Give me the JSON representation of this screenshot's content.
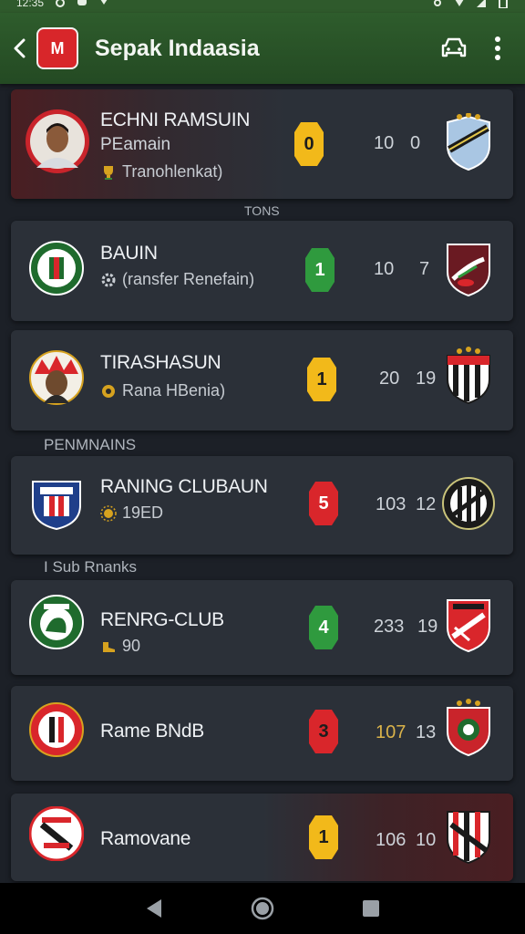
{
  "status_bar": {
    "time": "12:35"
  },
  "app_bar": {
    "title": "Sepak Indaasia",
    "logo_text": "M"
  },
  "sections": [
    "TONS",
    "PENMNAINS",
    "I Sub Rnanks"
  ],
  "matches": [
    {
      "title": "ECHNI RAMSUIN",
      "subtitle": "PEamain",
      "detail": "Tranohlenkat)",
      "rank": "0",
      "rank_color": "#f2b91a",
      "stat_a": "10",
      "stat_b": "0"
    },
    {
      "title": "BAUIN",
      "detail": "(ransfer Renefain)",
      "rank": "1",
      "rank_color": "#2f9a3e",
      "stat_a": "10",
      "stat_b": "7"
    },
    {
      "title": "TIRASHASUN",
      "detail": "Rana HBenia)",
      "rank": "1",
      "rank_color": "#f2b91a",
      "stat_a": "20",
      "stat_b": "19"
    },
    {
      "title": "RANING CLUBAUN",
      "detail": "19ED",
      "rank": "5",
      "rank_color": "#d9262b",
      "stat_a": "103",
      "stat_b": "12"
    },
    {
      "title": "RENRG-CLUB",
      "detail": "90",
      "rank": "4",
      "rank_color": "#2f9a3e",
      "stat_a": "233",
      "stat_b": "19"
    },
    {
      "title": "Rame BNdB",
      "rank": "3",
      "rank_color": "#d9262b",
      "stat_a": "107",
      "stat_b": "13"
    },
    {
      "title": "Ramovane",
      "rank": "1",
      "rank_color": "#f2b91a",
      "stat_a": "106",
      "stat_b": "10"
    }
  ],
  "colors": {
    "app_bar": "#2e5c2c",
    "background": "#1c2027",
    "card": "#2b3038"
  }
}
